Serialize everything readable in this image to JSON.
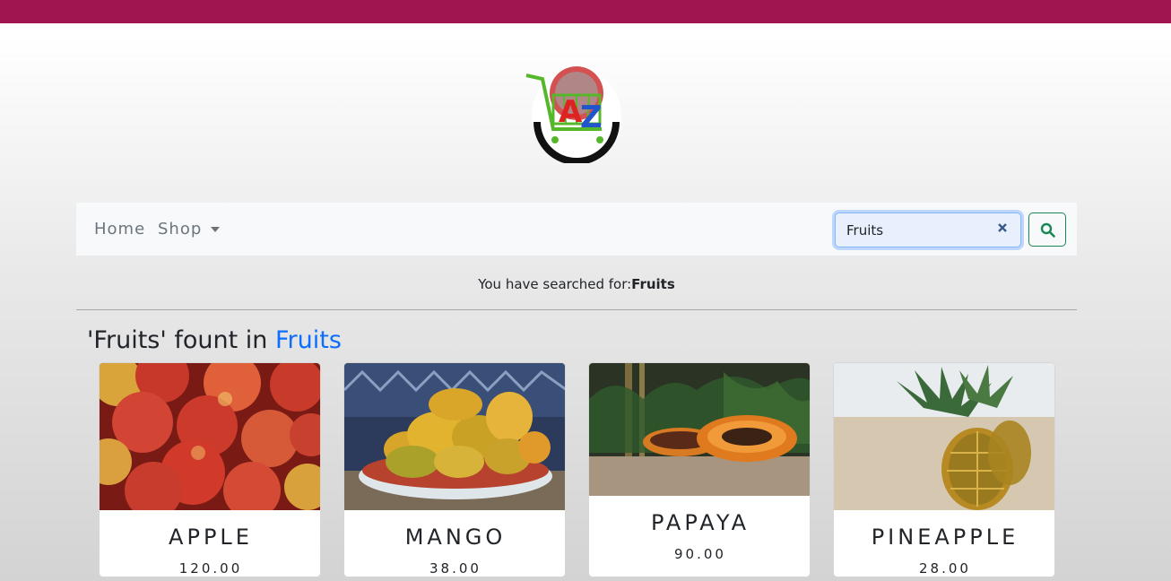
{
  "nav": {
    "home": "Home",
    "shop": "Shop"
  },
  "search": {
    "value": "Fruits",
    "placeholder": "Search"
  },
  "searched": {
    "prefix": "You have searched for:",
    "term": "Fruits"
  },
  "results": {
    "quoted": "'Fruits' fount in ",
    "category": "Fruits"
  },
  "products": [
    {
      "name": "APPLE",
      "price": "120.00"
    },
    {
      "name": "MANGO",
      "price": "38.00"
    },
    {
      "name": "PAPAYA",
      "price": "90.00"
    },
    {
      "name": "PINEAPPLE",
      "price": "28.00"
    }
  ],
  "colors": {
    "topbar": "#a01550",
    "accent": "#0d6efd",
    "success": "#198754"
  }
}
